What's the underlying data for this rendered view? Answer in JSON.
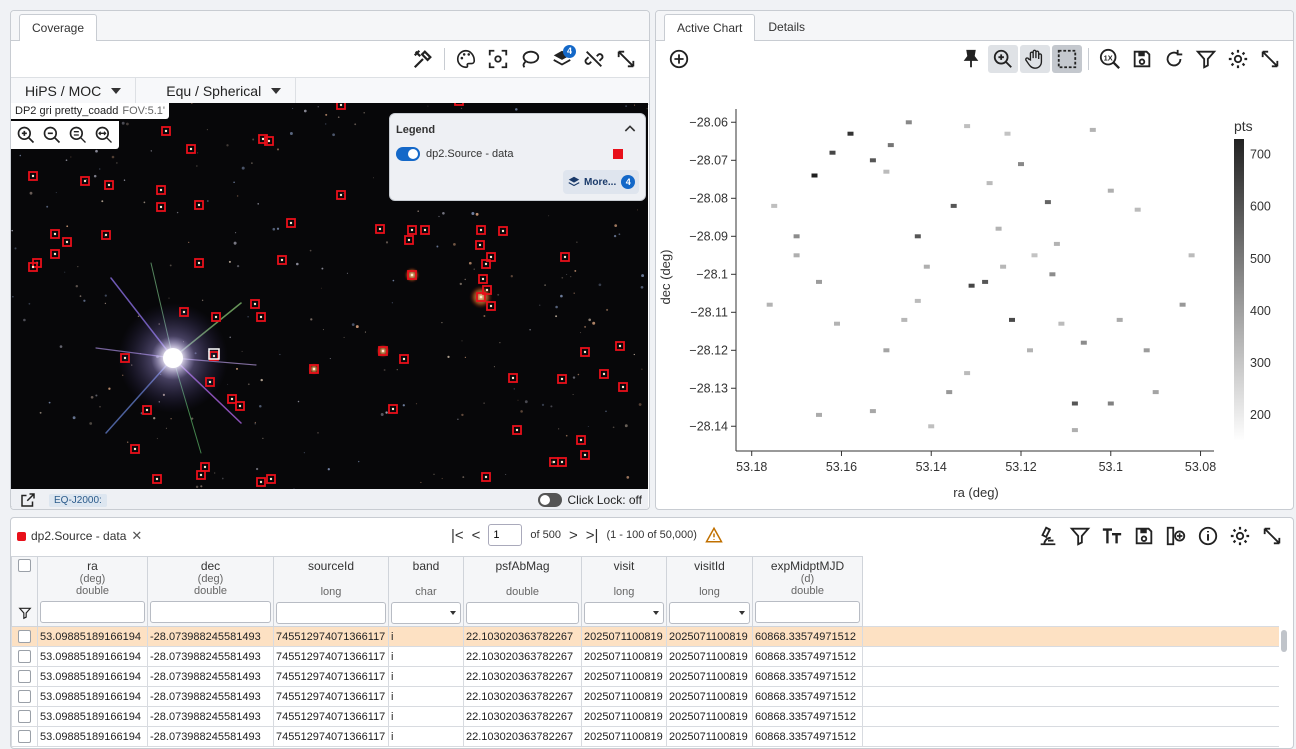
{
  "coverage": {
    "tab": "Coverage",
    "hips_dropdown": "HiPS / MOC",
    "coord_dropdown": "Equ / Spherical",
    "layers_badge": "4",
    "image_title": "DP2 gri pretty_coadd",
    "fov": "FOV:5.1'",
    "legend": {
      "title": "Legend",
      "layer_name": "dp2.Source - data",
      "more_label": "More...",
      "more_badge": "4"
    },
    "footer": {
      "coord_sys": "EQ-J2000:",
      "click_lock": "Click Lock: off"
    }
  },
  "chart_panel": {
    "tabs": [
      "Active Chart",
      "Details"
    ]
  },
  "chart_data": {
    "type": "heatmap",
    "xlabel": "ra (deg)",
    "ylabel": "dec (deg)",
    "x_ticks": [
      "53.18",
      "53.16",
      "53.14",
      "53.12",
      "53.1",
      "53.08"
    ],
    "y_ticks": [
      "−28.06",
      "−28.07",
      "−28.08",
      "−28.09",
      "−28.1",
      "−28.11",
      "−28.12",
      "−28.13",
      "−28.14"
    ],
    "colorbar_title": "pts",
    "colorbar_ticks": [
      "700",
      "600",
      "500",
      "400",
      "300",
      "200"
    ],
    "xlim": [
      53.1835,
      53.077
    ],
    "ylim": [
      -28.1465,
      -28.0565
    ],
    "cells": [
      [
        53.17,
        -28.09,
        420
      ],
      [
        53.176,
        -28.108,
        320
      ],
      [
        53.165,
        -28.102,
        380
      ],
      [
        53.158,
        -28.063,
        650
      ],
      [
        53.153,
        -28.07,
        560
      ],
      [
        53.131,
        -28.103,
        600
      ],
      [
        53.128,
        -28.102,
        560
      ],
      [
        53.122,
        -28.112,
        590
      ],
      [
        53.114,
        -28.081,
        520
      ],
      [
        53.108,
        -28.134,
        560
      ],
      [
        53.106,
        -28.118,
        420
      ],
      [
        53.1,
        -28.134,
        450
      ],
      [
        53.143,
        -28.09,
        560
      ],
      [
        53.135,
        -28.082,
        560
      ],
      [
        53.162,
        -28.068,
        600
      ],
      [
        53.166,
        -28.074,
        700
      ],
      [
        53.145,
        -28.06,
        430
      ],
      [
        53.149,
        -28.066,
        480
      ],
      [
        53.12,
        -28.071,
        430
      ],
      [
        53.136,
        -28.131,
        390
      ],
      [
        53.113,
        -28.1,
        420
      ],
      [
        53.092,
        -28.12,
        380
      ],
      [
        53.084,
        -28.108,
        390
      ],
      [
        53.15,
        -28.12,
        360
      ],
      [
        53.141,
        -28.098,
        330
      ],
      [
        53.125,
        -28.088,
        320
      ],
      [
        53.17,
        -28.095,
        330
      ],
      [
        53.153,
        -28.136,
        350
      ],
      [
        53.127,
        -28.076,
        300
      ],
      [
        53.1,
        -28.078,
        330
      ],
      [
        53.161,
        -28.113,
        320
      ],
      [
        53.165,
        -28.137,
        340
      ],
      [
        53.146,
        -28.112,
        310
      ],
      [
        53.118,
        -28.12,
        320
      ],
      [
        53.112,
        -28.092,
        320
      ],
      [
        53.098,
        -28.112,
        340
      ],
      [
        53.09,
        -28.131,
        360
      ],
      [
        53.082,
        -28.095,
        300
      ],
      [
        53.175,
        -28.082,
        290
      ],
      [
        53.143,
        -28.107,
        300
      ],
      [
        53.132,
        -28.061,
        290
      ],
      [
        53.104,
        -28.062,
        320
      ],
      [
        53.108,
        -28.141,
        330
      ],
      [
        53.124,
        -28.098,
        310
      ],
      [
        53.15,
        -28.073,
        300
      ],
      [
        53.117,
        -28.095,
        280
      ],
      [
        53.132,
        -28.126,
        300
      ],
      [
        53.14,
        -28.14,
        290
      ],
      [
        53.123,
        -28.063,
        280
      ],
      [
        53.094,
        -28.083,
        300
      ],
      [
        53.111,
        -28.113,
        300
      ]
    ]
  },
  "table": {
    "chip_label": "dp2.Source - data",
    "page_value": "1",
    "page_of": "of 500",
    "range_text": "(1 - 100 of 50,000)",
    "columns": [
      {
        "name": "ra",
        "unit": "(deg)",
        "type": "double"
      },
      {
        "name": "dec",
        "unit": "(deg)",
        "type": "double"
      },
      {
        "name": "sourceId",
        "unit": "",
        "type": "long"
      },
      {
        "name": "band",
        "unit": "",
        "type": "char"
      },
      {
        "name": "psfAbMag",
        "unit": "",
        "type": "double"
      },
      {
        "name": "visit",
        "unit": "",
        "type": "long"
      },
      {
        "name": "visitId",
        "unit": "",
        "type": "long"
      },
      {
        "name": "expMidptMJD",
        "unit": "(d)",
        "type": "double"
      }
    ],
    "rows": [
      [
        "53.09885189166194",
        "-28.073988245581493",
        "745512974071366117",
        "i",
        "22.103020363782267",
        "2025071100819",
        "2025071100819",
        "60868.33574971512"
      ],
      [
        "53.09885189166194",
        "-28.073988245581493",
        "745512974071366117",
        "i",
        "22.103020363782267",
        "2025071100819",
        "2025071100819",
        "60868.33574971512"
      ],
      [
        "53.09885189166194",
        "-28.073988245581493",
        "745512974071366117",
        "i",
        "22.103020363782267",
        "2025071100819",
        "2025071100819",
        "60868.33574971512"
      ],
      [
        "53.09885189166194",
        "-28.073988245581493",
        "745512974071366117",
        "i",
        "22.103020363782267",
        "2025071100819",
        "2025071100819",
        "60868.33574971512"
      ],
      [
        "53.09885189166194",
        "-28.073988245581493",
        "745512974071366117",
        "i",
        "22.103020363782267",
        "2025071100819",
        "2025071100819",
        "60868.33574971512"
      ],
      [
        "53.09885189166194",
        "-28.073988245581493",
        "745512974071366117",
        "i",
        "22.103020363782267",
        "2025071100819",
        "2025071100819",
        "60868.33574971512"
      ]
    ]
  },
  "colors": {
    "marker": "#e8101a",
    "accent": "#1468c8",
    "highlight_row": "#fde1c3"
  }
}
